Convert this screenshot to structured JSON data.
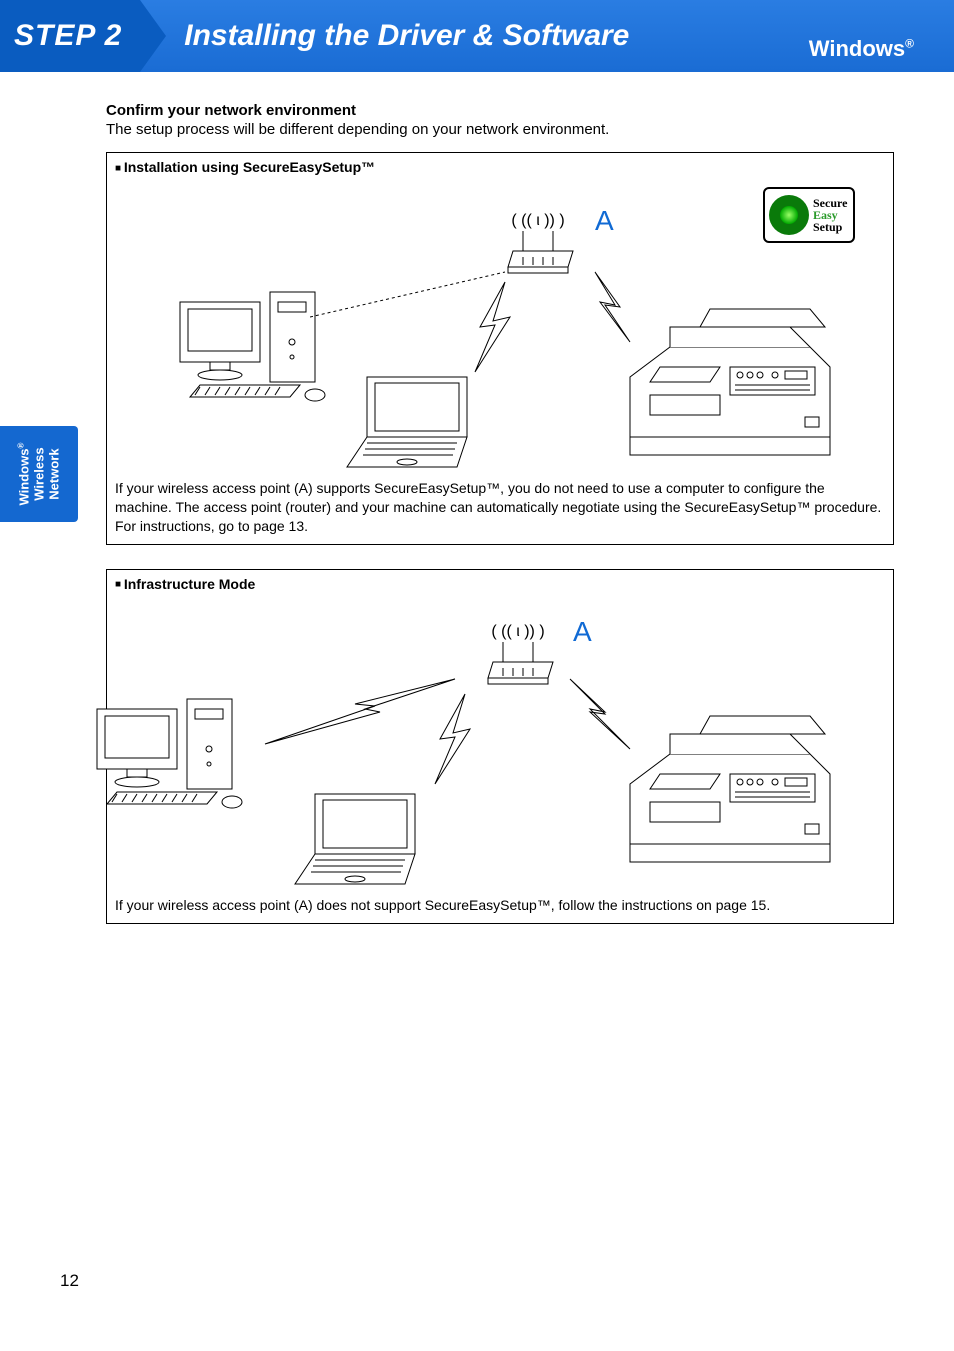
{
  "header": {
    "step_label": "STEP 2",
    "title": "Installing the Driver & Software",
    "os": "Windows",
    "os_reg": "®"
  },
  "side_tab": {
    "line1": "Windows",
    "line1_reg": "®",
    "line2": "Wireless",
    "line3": "Network"
  },
  "intro": {
    "title": "Confirm your network environment",
    "text": "The setup process will be different depending on your network environment."
  },
  "section1": {
    "title": "Installation using SecureEasySetup™",
    "label_A": "A",
    "ses_logo": {
      "line1": "Secure",
      "line2": "Easy",
      "line3": "Setup"
    },
    "caption": "If your wireless access point (A) supports SecureEasySetup™, you do not need to use a computer to configure the machine. The access point (router) and your machine can automatically negotiate using the SecureEasySetup™ procedure. For instructions, go to page 13."
  },
  "section2": {
    "title": "Infrastructure Mode",
    "label_A": "A",
    "caption": "If your wireless access point (A) does not support SecureEasySetup™, follow the instructions on page 15."
  },
  "page_number": "12"
}
